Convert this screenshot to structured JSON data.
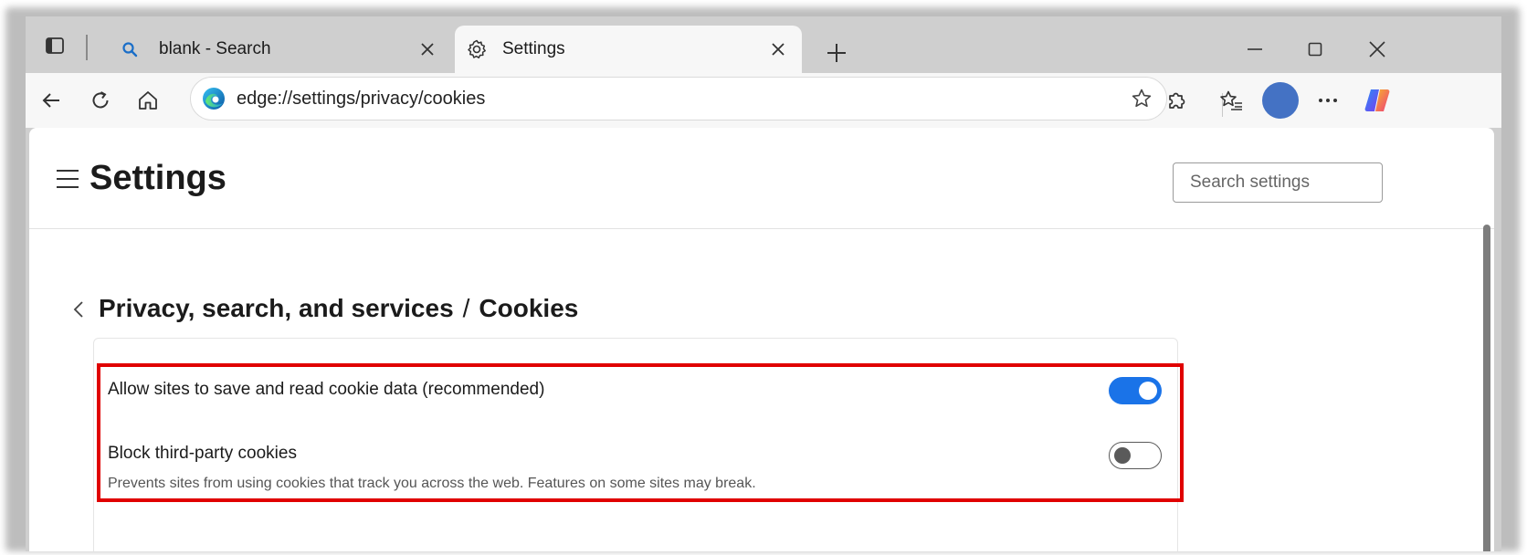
{
  "browser": {
    "tabs": [
      {
        "title": "blank - Search",
        "icon": "search-icon",
        "active": false
      },
      {
        "title": "Settings",
        "icon": "gear-icon",
        "active": true
      }
    ],
    "address_bar": {
      "url": "edge://settings/privacy/cookies"
    }
  },
  "settings": {
    "title": "Settings",
    "search_placeholder": "Search settings",
    "breadcrumb": {
      "parent": "Privacy, search, and services",
      "separator": "/",
      "current": "Cookies"
    },
    "options": [
      {
        "label": "Allow sites to save and read cookie data (recommended)",
        "enabled": true
      },
      {
        "label": "Block third-party cookies",
        "description": "Prevents sites from using cookies that track you across the web. Features on some sites may break.",
        "enabled": false
      }
    ]
  },
  "colors": {
    "accent": "#1a73e8",
    "highlight": "#e00000",
    "avatar": "#4472c4"
  }
}
